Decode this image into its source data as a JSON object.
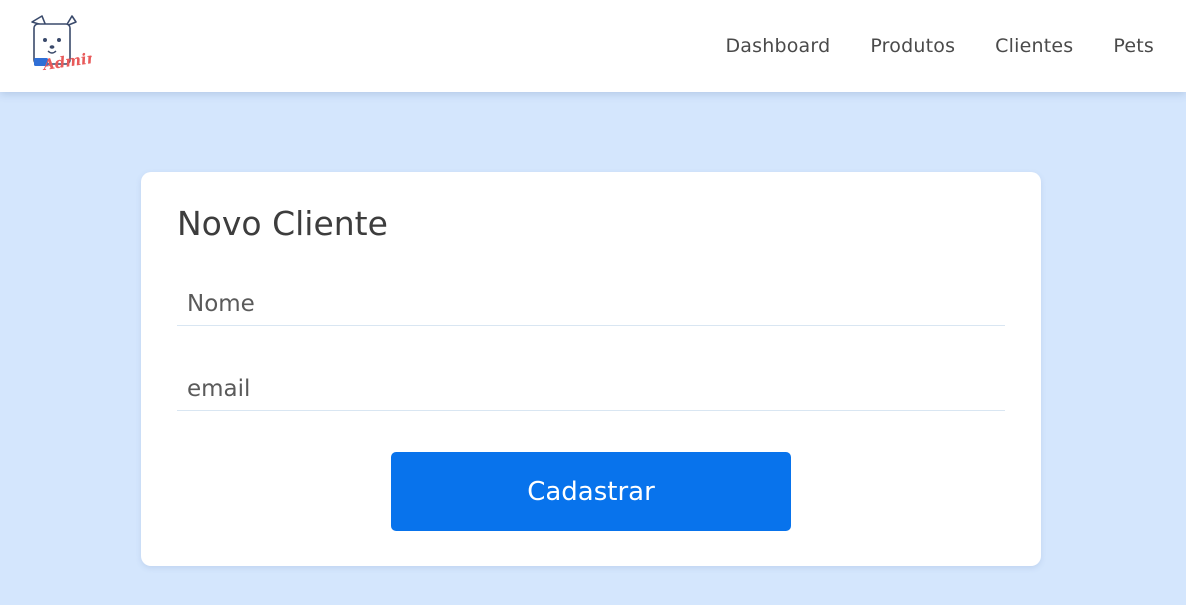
{
  "header": {
    "logo": {
      "icon": "dog-mascot-icon",
      "text": "Admin",
      "accent_color": "#e85a5a",
      "tag_color": "#2f6fd6"
    },
    "nav": [
      {
        "label": "Dashboard"
      },
      {
        "label": "Produtos"
      },
      {
        "label": "Clientes"
      },
      {
        "label": "Pets"
      }
    ]
  },
  "form": {
    "title": "Novo Cliente",
    "fields": {
      "nome": {
        "value": "",
        "placeholder": "Nome"
      },
      "email": {
        "value": "",
        "placeholder": "email"
      }
    },
    "submit_label": "Cadastrar",
    "submit_color": "#0873ec"
  },
  "colors": {
    "page_background": "#d4e6fd",
    "card_background": "#ffffff"
  }
}
